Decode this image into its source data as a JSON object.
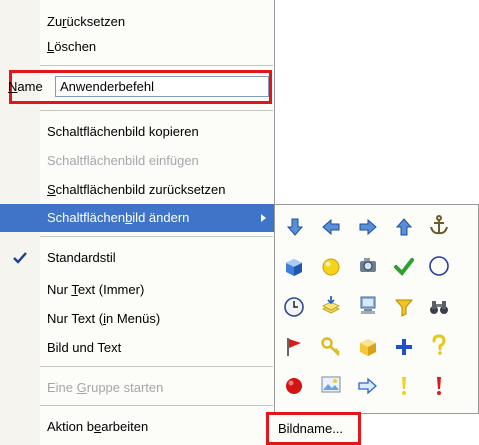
{
  "menu": {
    "reset_label": "Zurücksetzen",
    "delete_label": "Löschen",
    "name_label": "Name",
    "name_value": "Anwenderbefehl",
    "copy_image": "Schaltflächenbild kopieren",
    "paste_image": "Schaltflächenbild einfügen",
    "reset_image": "Schaltflächenbild zurücksetzen",
    "change_image": "Schaltflächenbild ändern",
    "default_style": "Standardstil",
    "text_only_always": "Nur Text (Immer)",
    "text_only_menus": "Nur Text (in Menüs)",
    "image_and_text": "Bild und Text",
    "begin_group": "Eine Gruppe starten",
    "edit_action": "Aktion bearbeiten"
  },
  "palette": {
    "icons": [
      "down-arrow-icon",
      "left-arrow-icon",
      "right-arrow-icon",
      "up-arrow-icon",
      "anchor-icon",
      "cube-icon",
      "yellow-circle-icon",
      "camera-icon",
      "green-check-icon",
      "blue-circle-outline-icon",
      "clock-icon",
      "stacked-papers-icon",
      "computer-icon",
      "funnel-icon",
      "binoculars-icon",
      "red-flag-icon",
      "key-icon",
      "box-icon",
      "blue-plus-icon",
      "question-mark-icon",
      "red-ball-icon",
      "picture-icon",
      "hollow-arrow-icon",
      "yellow-exclamation-icon",
      "red-exclamation-icon"
    ],
    "bildname_label": "Bildname..."
  },
  "colors": {
    "highlight": "#3f74c9",
    "annotation_red": "#e4151a",
    "disabled_text": "#a7a6aa"
  }
}
